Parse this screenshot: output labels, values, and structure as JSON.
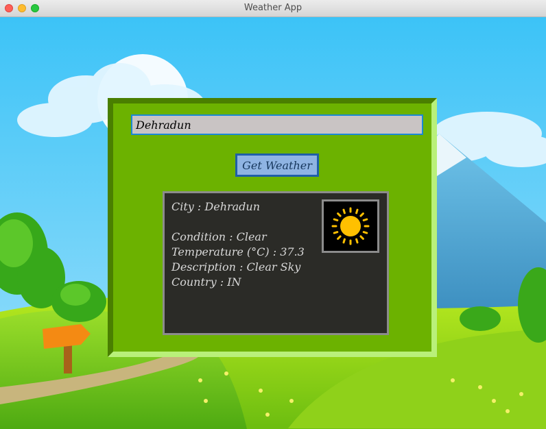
{
  "window": {
    "title": "Weather App"
  },
  "search": {
    "value": "Dehradun"
  },
  "actions": {
    "get_weather_label": "Get Weather"
  },
  "result": {
    "city": "City : Dehradun",
    "condition": "Condition : Clear",
    "temperature": "Temperature (°C) : 37.3",
    "description": "Description : Clear Sky",
    "country": "Country : IN",
    "icon": "sun-icon"
  },
  "colors": {
    "panel": "#6cb200",
    "result_background": "#2b2b27",
    "button": "#8fb4e3",
    "input": "#c9c4c4",
    "sun": "#ffc000"
  }
}
